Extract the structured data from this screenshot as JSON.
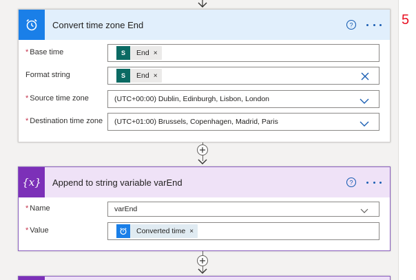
{
  "annotation": {
    "step_number": "5"
  },
  "card1": {
    "title": "Convert time zone End",
    "header_color": "#e1effc",
    "icon_color": "#1a7fe8",
    "fields": {
      "base_time": {
        "label": "Base time",
        "required": true,
        "token": "End"
      },
      "format_string": {
        "label": "Format string",
        "required": false,
        "token": "End"
      },
      "source_time_zone": {
        "label": "Source time zone",
        "required": true,
        "value": "(UTC+00:00) Dublin, Edinburgh, Lisbon, London"
      },
      "destination_time_zone": {
        "label": "Destination time zone",
        "required": true,
        "value": "(UTC+01:00) Brussels, Copenhagen, Madrid, Paris"
      }
    }
  },
  "card2": {
    "title": "Append to string variable varEnd",
    "header_color": "#efe2f7",
    "icon_color": "#7c30b8",
    "icon_label": "{x}",
    "fields": {
      "name": {
        "label": "Name",
        "required": true,
        "value": "varEnd"
      },
      "value": {
        "label": "Value",
        "required": true,
        "token": "Converted time"
      }
    }
  },
  "icons": {
    "card1_header": "alarm-clock-icon",
    "card2_header": "variable-icon",
    "help": "help-circle-icon",
    "more": "more-options-icon",
    "sharepoint_token": "sharepoint-icon",
    "converted_time_token": "alarm-clock-icon"
  },
  "token_x": "×"
}
